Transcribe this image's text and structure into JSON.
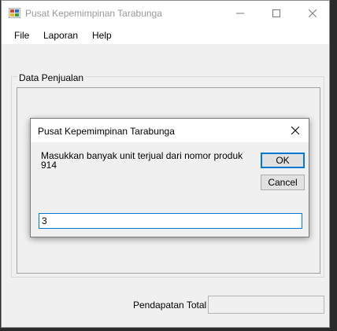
{
  "window": {
    "title": "Pusat Kepemimpinan Tarabunga"
  },
  "menu": {
    "items": [
      "File",
      "Laporan",
      "Help"
    ]
  },
  "groupbox": {
    "title": "Data Penjualan"
  },
  "footer": {
    "total_label": "Pendapatan Total",
    "total_value": ""
  },
  "dialog": {
    "title": "Pusat Kepemimpinan Tarabunga",
    "prompt_line1": "Masukkan banyak unit terjual dari nomor produk",
    "prompt_line2": "914",
    "ok_label": "OK",
    "cancel_label": "Cancel",
    "input_value": "3"
  }
}
